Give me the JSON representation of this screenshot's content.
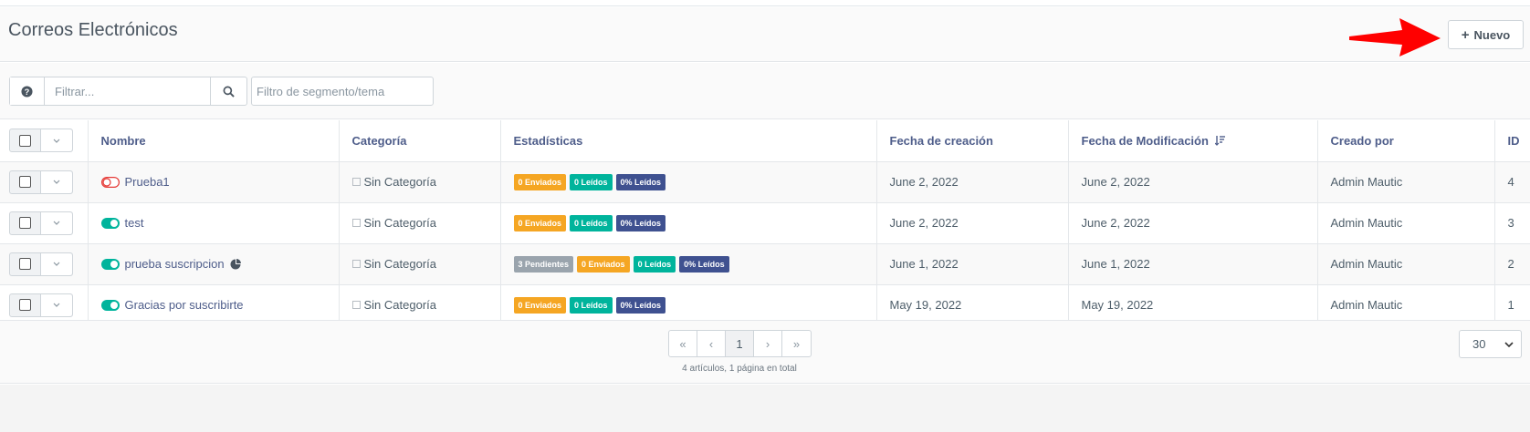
{
  "page": {
    "title": "Correos Electrónicos",
    "new_button_label": "Nuevo"
  },
  "toolbar": {
    "filter_placeholder": "Filtrar...",
    "segment_filter_placeholder": "Filtro de segmento/tema"
  },
  "table": {
    "columns": [
      "Nombre",
      "Categoría",
      "Estadísticas",
      "Fecha de creación",
      "Fecha de Modificación",
      "Creado por",
      "ID"
    ],
    "rows": [
      {
        "name": "Prueba1",
        "published": false,
        "has_segment_icon": false,
        "category": "Sin Categoría",
        "stats": [
          {
            "label": "0 Enviados",
            "color": "#f5a623"
          },
          {
            "label": "0 Leídos",
            "color": "#00b49c"
          },
          {
            "label": "0% Leídos",
            "color": "#3f5190"
          }
        ],
        "created": "June 2, 2022",
        "modified": "June 2, 2022",
        "created_by": "Admin Mautic",
        "id": "4"
      },
      {
        "name": "test",
        "published": true,
        "has_segment_icon": false,
        "category": "Sin Categoría",
        "stats": [
          {
            "label": "0 Enviados",
            "color": "#f5a623"
          },
          {
            "label": "0 Leídos",
            "color": "#00b49c"
          },
          {
            "label": "0% Leídos",
            "color": "#3f5190"
          }
        ],
        "created": "June 2, 2022",
        "modified": "June 2, 2022",
        "created_by": "Admin Mautic",
        "id": "3"
      },
      {
        "name": "prueba suscripcion",
        "published": true,
        "has_segment_icon": true,
        "category": "Sin Categoría",
        "stats": [
          {
            "label": "3 Pendientes",
            "color": "#9aa4ad"
          },
          {
            "label": "0 Enviados",
            "color": "#f5a623"
          },
          {
            "label": "0 Leídos",
            "color": "#00b49c"
          },
          {
            "label": "0% Leídos",
            "color": "#3f5190"
          }
        ],
        "created": "June 1, 2022",
        "modified": "June 1, 2022",
        "created_by": "Admin Mautic",
        "id": "2"
      },
      {
        "name": "Gracias por suscribirte",
        "published": true,
        "has_segment_icon": false,
        "category": "Sin Categoría",
        "stats": [
          {
            "label": "0 Enviados",
            "color": "#f5a623"
          },
          {
            "label": "0 Leídos",
            "color": "#00b49c"
          },
          {
            "label": "0% Leídos",
            "color": "#3f5190"
          }
        ],
        "created": "May 19, 2022",
        "modified": "May 19, 2022",
        "created_by": "Admin Mautic",
        "id": "1"
      }
    ]
  },
  "pagination": {
    "first": "«",
    "prev": "‹",
    "current": "1",
    "next": "›",
    "last": "»",
    "info": "4 artículos, 1 página en total",
    "per_page": "30"
  },
  "icons": {
    "help": "question-circle-icon",
    "search": "search-icon",
    "sort": "sort-desc-icon",
    "arrow": "red-arrow-annotation"
  },
  "colors": {
    "accent": "#4e5d8a",
    "published": "#00b49c",
    "unpublished": "#e53935",
    "arrow": "#ff0000"
  }
}
